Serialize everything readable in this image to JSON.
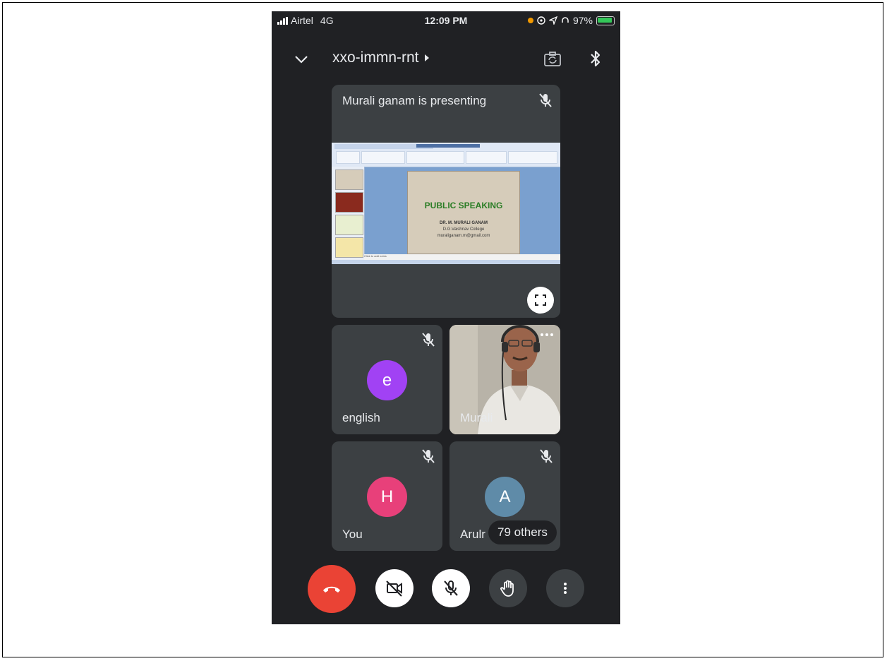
{
  "status_bar": {
    "carrier": "Airtel",
    "network": "4G",
    "time": "12:09 PM",
    "battery": "97%"
  },
  "header": {
    "meeting_code": "xxo-immn-rnt",
    "icons": [
      "chevron-down-icon",
      "switch-camera-icon",
      "bluetooth-icon"
    ]
  },
  "presentation": {
    "label": "Murali ganam is presenting",
    "slide": {
      "title": "PUBLIC SPEAKING",
      "lines": [
        "DR. M. MURALI GANAM",
        "D.G.Vaishnav College",
        "muraliganam.m@gmail.com"
      ],
      "notes_placeholder": "Click to add notes"
    }
  },
  "participants": [
    {
      "name": "english",
      "initial": "e",
      "color": "#a142f4",
      "muted": true
    },
    {
      "name": "Murali",
      "video": true
    },
    {
      "name": "You",
      "initial": "H",
      "color": "#e8407a",
      "muted": true
    },
    {
      "name": "Arulr",
      "initial": "A",
      "color": "#5f8ba8",
      "muted": true
    }
  ],
  "others_chip": "79 others",
  "controls": [
    "end-call-icon",
    "camera-off-icon",
    "mic-off-icon",
    "raise-hand-icon",
    "more-vert-icon"
  ],
  "colors": {
    "background": "#202124",
    "tile": "#3c4043",
    "end_call": "#ea4335"
  }
}
